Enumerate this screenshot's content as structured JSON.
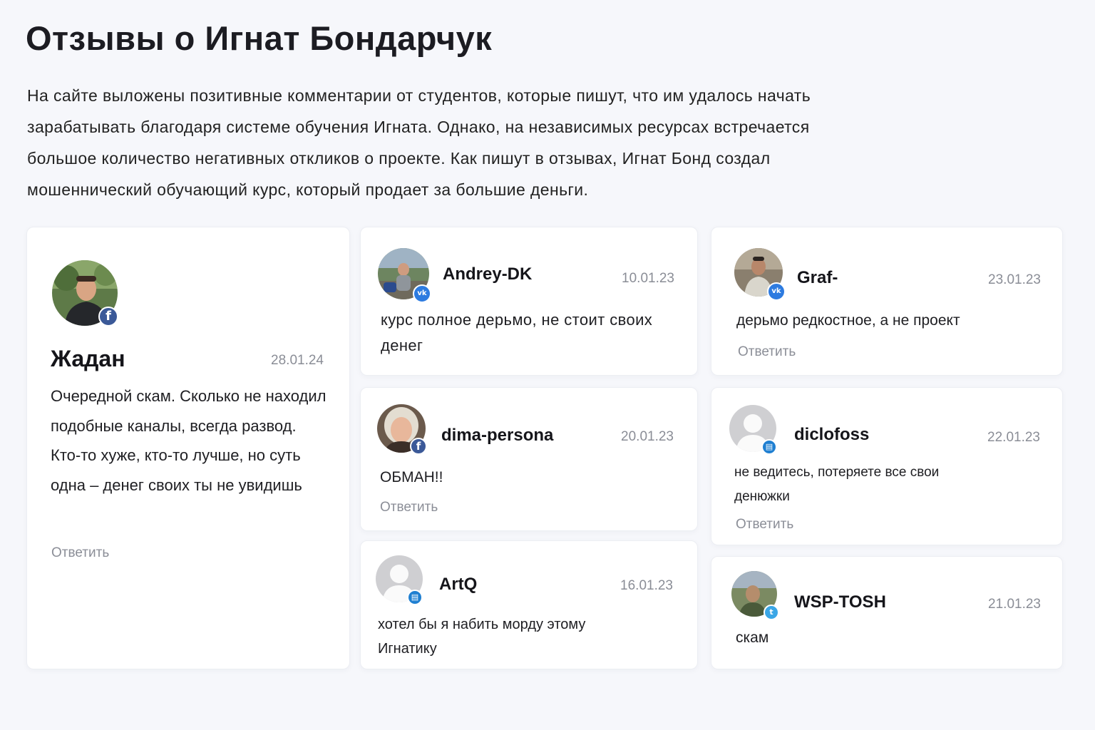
{
  "page": {
    "title": "Отзывы о Игнат Бондарчук",
    "intro": "На сайте выложены позитивные комментарии от студентов, которые пишут, что им удалось начать зарабатывать благодаря системе обучения Игната. Однако, на независимых ресурсах встречается большое количество негативных откликов о проекте. Как пишут в отзывах, Игнат Бонд создал мошеннический обучающий курс, который продает за большие деньги."
  },
  "colors": {
    "facebook": "#3b5998",
    "vk": "#2d7be0",
    "web": "#1f7fd1",
    "twitter": "#3aa6e6",
    "muted": "#8a8d96"
  },
  "reviews": [
    {
      "author": "Жадан",
      "date": "28.01.24",
      "text": "Очередной скам. Сколько не находил подобные каналы, всегда развод. Кто-то хуже, кто-то лучше, но суть одна – денег своих ты не увидишь",
      "reply": "Ответить",
      "source_icon": "facebook-icon"
    },
    {
      "author": "Andrey-DK",
      "date": "10.01.23",
      "text": "курс полное дерьмо, не стоит своих денег",
      "source_icon": "vk-icon"
    },
    {
      "author": "Graf-",
      "date": "23.01.23",
      "text": "дерьмо редкостное, а не проект",
      "reply": "Ответить",
      "source_icon": "vk-icon"
    },
    {
      "author": "dima-persona",
      "date": "20.01.23",
      "text": "ОБМАН!!",
      "reply": "Ответить",
      "source_icon": "facebook-icon"
    },
    {
      "author": "diclofoss",
      "date": "22.01.23",
      "text": "не ведитесь, потеряете все свои денюжки",
      "reply": "Ответить",
      "source_icon": "web-icon"
    },
    {
      "author": "ArtQ",
      "date": "16.01.23",
      "text": "хотел бы я набить морду этому Игнатику",
      "source_icon": "web-icon"
    },
    {
      "author": "WSP-TOSH",
      "date": "21.01.23",
      "text": "скам",
      "source_icon": "twitter-icon"
    }
  ]
}
